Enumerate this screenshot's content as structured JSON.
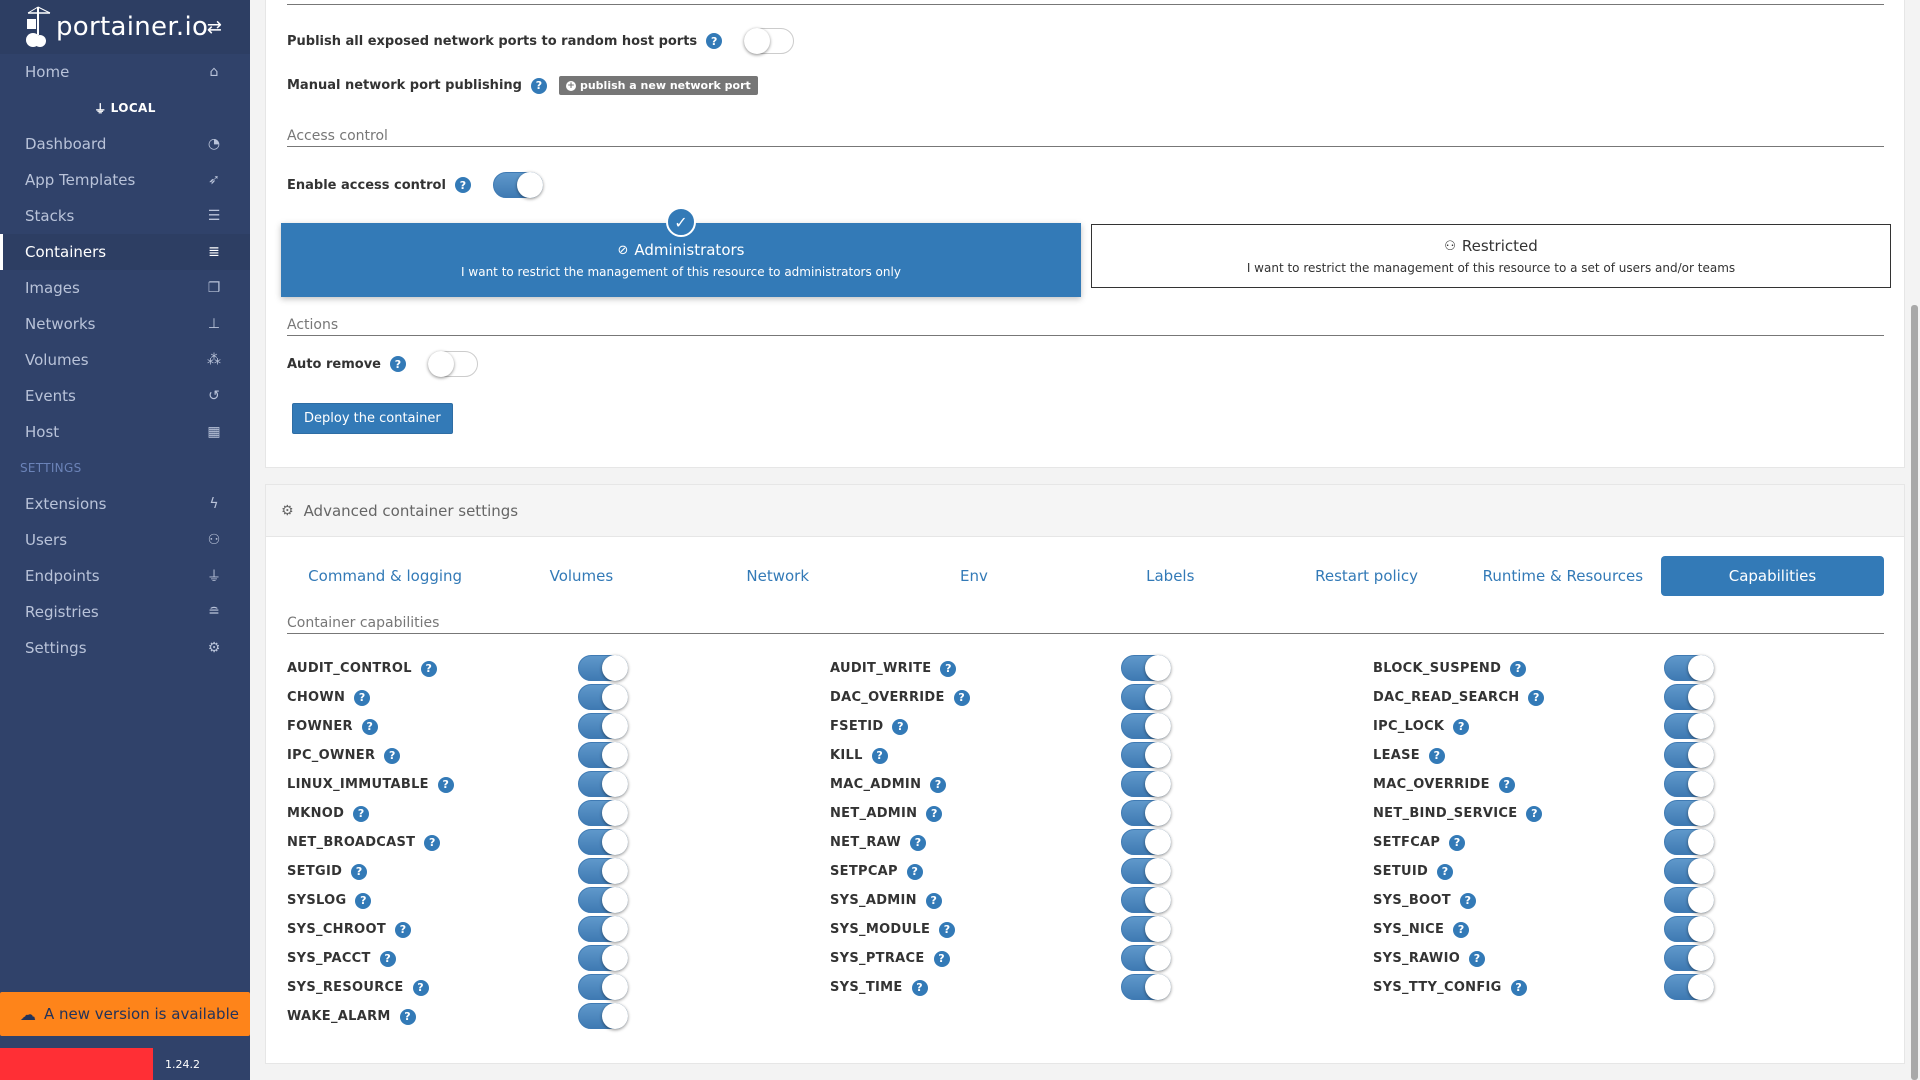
{
  "sidebar": {
    "logo_text": "portainer.io",
    "items_top": [
      {
        "label": "Home",
        "icon": "home-icon",
        "glyph": "⌂"
      }
    ],
    "environment_label": "LOCAL",
    "items_env": [
      {
        "label": "Dashboard",
        "icon": "tachometer-icon",
        "glyph": "◔",
        "active": false
      },
      {
        "label": "App Templates",
        "icon": "rocket-icon",
        "glyph": "➶",
        "active": false
      },
      {
        "label": "Stacks",
        "icon": "list-icon",
        "glyph": "☰",
        "active": false
      },
      {
        "label": "Containers",
        "icon": "server-icon",
        "glyph": "≣",
        "active": true
      },
      {
        "label": "Images",
        "icon": "clone-icon",
        "glyph": "❐",
        "active": false
      },
      {
        "label": "Networks",
        "icon": "sitemap-icon",
        "glyph": "⊥",
        "active": false
      },
      {
        "label": "Volumes",
        "icon": "cubes-icon",
        "glyph": "⁂",
        "active": false
      },
      {
        "label": "Events",
        "icon": "history-icon",
        "glyph": "↺",
        "active": false
      },
      {
        "label": "Host",
        "icon": "th-icon",
        "glyph": "▦",
        "active": false
      }
    ],
    "settings_label": "SETTINGS",
    "items_settings": [
      {
        "label": "Extensions",
        "icon": "bolt-icon",
        "glyph": "ϟ"
      },
      {
        "label": "Users",
        "icon": "users-icon",
        "glyph": "⚇"
      },
      {
        "label": "Endpoints",
        "icon": "plug-icon",
        "glyph": "⏚"
      },
      {
        "label": "Registries",
        "icon": "database-icon",
        "glyph": "≘"
      },
      {
        "label": "Settings",
        "icon": "cogs-icon",
        "glyph": "⚙"
      }
    ],
    "update_banner": "A new version is available",
    "version": "1.24.2"
  },
  "network": {
    "publish_all_label": "Publish all exposed network ports to random host ports",
    "publish_all_enabled": false,
    "manual_publish_label": "Manual network port publishing",
    "publish_button": "publish a new network port"
  },
  "access_control": {
    "section_title": "Access control",
    "enable_label": "Enable access control",
    "enabled": true,
    "options": [
      {
        "title": "Administrators",
        "description": "I want to restrict the management of this resource to administrators only",
        "selected": true
      },
      {
        "title": "Restricted",
        "description": "I want to restrict the management of this resource to a set of users and/or teams",
        "selected": false
      }
    ]
  },
  "actions": {
    "section_title": "Actions",
    "auto_remove_label": "Auto remove",
    "auto_remove_enabled": false,
    "deploy_button": "Deploy the container"
  },
  "advanced": {
    "title": "Advanced container settings",
    "tabs": [
      {
        "label": "Command & logging",
        "active": false
      },
      {
        "label": "Volumes",
        "active": false
      },
      {
        "label": "Network",
        "active": false
      },
      {
        "label": "Env",
        "active": false
      },
      {
        "label": "Labels",
        "active": false
      },
      {
        "label": "Restart policy",
        "active": false
      },
      {
        "label": "Runtime & Resources",
        "active": false
      },
      {
        "label": "Capabilities",
        "active": true
      }
    ],
    "capabilities_title": "Container capabilities",
    "capability_columns": [
      [
        {
          "name": "AUDIT_CONTROL",
          "enabled": true
        },
        {
          "name": "CHOWN",
          "enabled": true
        },
        {
          "name": "FOWNER",
          "enabled": true
        },
        {
          "name": "IPC_OWNER",
          "enabled": true
        },
        {
          "name": "LINUX_IMMUTABLE",
          "enabled": true
        },
        {
          "name": "MKNOD",
          "enabled": true
        },
        {
          "name": "NET_BROADCAST",
          "enabled": true
        },
        {
          "name": "SETGID",
          "enabled": true
        },
        {
          "name": "SYSLOG",
          "enabled": true
        },
        {
          "name": "SYS_CHROOT",
          "enabled": true
        },
        {
          "name": "SYS_PACCT",
          "enabled": true
        },
        {
          "name": "SYS_RESOURCE",
          "enabled": true
        },
        {
          "name": "WAKE_ALARM",
          "enabled": true
        }
      ],
      [
        {
          "name": "AUDIT_WRITE",
          "enabled": true
        },
        {
          "name": "DAC_OVERRIDE",
          "enabled": true
        },
        {
          "name": "FSETID",
          "enabled": true
        },
        {
          "name": "KILL",
          "enabled": true
        },
        {
          "name": "MAC_ADMIN",
          "enabled": true
        },
        {
          "name": "NET_ADMIN",
          "enabled": true
        },
        {
          "name": "NET_RAW",
          "enabled": true
        },
        {
          "name": "SETPCAP",
          "enabled": true
        },
        {
          "name": "SYS_ADMIN",
          "enabled": true
        },
        {
          "name": "SYS_MODULE",
          "enabled": true
        },
        {
          "name": "SYS_PTRACE",
          "enabled": true
        },
        {
          "name": "SYS_TIME",
          "enabled": true
        }
      ],
      [
        {
          "name": "BLOCK_SUSPEND",
          "enabled": true
        },
        {
          "name": "DAC_READ_SEARCH",
          "enabled": true
        },
        {
          "name": "IPC_LOCK",
          "enabled": true
        },
        {
          "name": "LEASE",
          "enabled": true
        },
        {
          "name": "MAC_OVERRIDE",
          "enabled": true
        },
        {
          "name": "NET_BIND_SERVICE",
          "enabled": true
        },
        {
          "name": "SETFCAP",
          "enabled": true
        },
        {
          "name": "SETUID",
          "enabled": true
        },
        {
          "name": "SYS_BOOT",
          "enabled": true
        },
        {
          "name": "SYS_NICE",
          "enabled": true
        },
        {
          "name": "SYS_RAWIO",
          "enabled": true
        },
        {
          "name": "SYS_TTY_CONFIG",
          "enabled": true
        }
      ]
    ]
  },
  "colors": {
    "sidebar": "#30426a",
    "primary": "#337ab7",
    "update_banner": "#fe841a"
  }
}
